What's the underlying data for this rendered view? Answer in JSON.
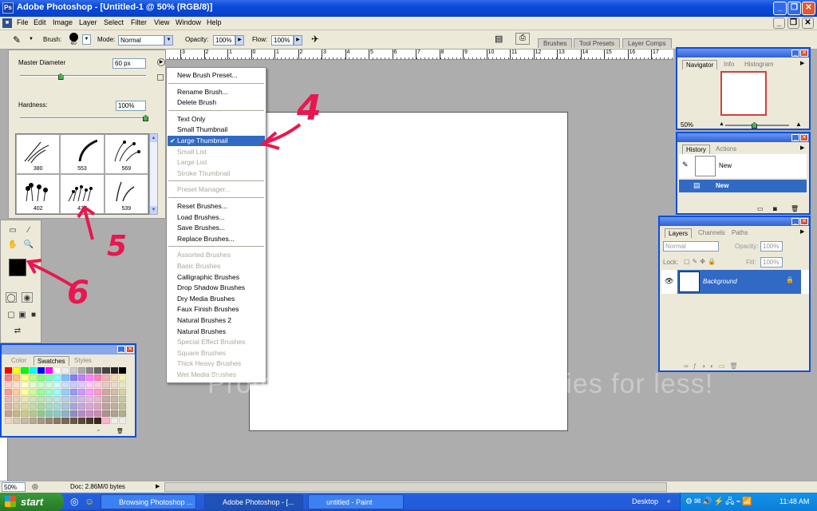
{
  "window": {
    "title": "Adobe Photoshop - [Untitled-1 @ 50% (RGB/8)]"
  },
  "menu": [
    "File",
    "Edit",
    "Image",
    "Layer",
    "Select",
    "Filter",
    "View",
    "Window",
    "Help"
  ],
  "options_bar": {
    "brush_label": "Brush:",
    "brush_size": "60",
    "mode_label": "Mode:",
    "mode_value": "Normal",
    "opacity_label": "Opacity:",
    "opacity_value": "100%",
    "flow_label": "Flow:",
    "flow_value": "100%",
    "well_tabs": [
      "Brushes",
      "Tool Presets",
      "Layer Comps"
    ]
  },
  "ruler_ticks": [
    "3",
    "2",
    "1",
    "0",
    "1",
    "2",
    "3",
    "4",
    "5",
    "6",
    "7",
    "8",
    "9",
    "10",
    "11",
    "12",
    "13",
    "14",
    "15",
    "16",
    "17"
  ],
  "brush_picker": {
    "master_diameter_label": "Master Diameter",
    "master_diameter_value": "60 px",
    "master_diameter_level": 0.32,
    "hardness_label": "Hardness:",
    "hardness_value": "100%",
    "hardness_level": 1.0,
    "thumbnails": [
      "380",
      "553",
      "569",
      "402",
      "437",
      "539"
    ]
  },
  "context_menu": {
    "items": [
      {
        "label": "New Brush Preset...",
        "disabled": false
      },
      {
        "sep": true
      },
      {
        "label": "Rename Brush...",
        "disabled": false
      },
      {
        "label": "Delete Brush",
        "disabled": false
      },
      {
        "sep": true
      },
      {
        "label": "Text Only",
        "disabled": false
      },
      {
        "label": "Small Thumbnail",
        "disabled": false
      },
      {
        "label": "Large Thumbnail",
        "disabled": false,
        "selected": true,
        "checked": true
      },
      {
        "label": "Small List",
        "disabled": true
      },
      {
        "label": "Large List",
        "disabled": true
      },
      {
        "label": "Stroke Thumbnail",
        "disabled": true
      },
      {
        "sep": true
      },
      {
        "label": "Preset Manager...",
        "disabled": true
      },
      {
        "sep": true
      },
      {
        "label": "Reset Brushes...",
        "disabled": false
      },
      {
        "label": "Load Brushes...",
        "disabled": false
      },
      {
        "label": "Save Brushes...",
        "disabled": false
      },
      {
        "label": "Replace Brushes...",
        "disabled": false
      },
      {
        "sep": true
      },
      {
        "label": "Assorted Brushes",
        "disabled": true
      },
      {
        "label": "Basic Brushes",
        "disabled": true
      },
      {
        "label": "Calligraphic Brushes",
        "disabled": false
      },
      {
        "label": "Drop Shadow Brushes",
        "disabled": false
      },
      {
        "label": "Dry Media Brushes",
        "disabled": false
      },
      {
        "label": "Faux Finish Brushes",
        "disabled": false
      },
      {
        "label": "Natural Brushes 2",
        "disabled": false
      },
      {
        "label": "Natural Brushes",
        "disabled": false
      },
      {
        "label": "Special Effect Brushes",
        "disabled": true
      },
      {
        "label": "Square Brushes",
        "disabled": true
      },
      {
        "label": "Thick Heavy Brushes",
        "disabled": true
      },
      {
        "label": "Wet Media Brushes",
        "disabled": true
      }
    ]
  },
  "swatches_panel": {
    "tabs": [
      "Color",
      "Swatches",
      "Styles"
    ],
    "active_tab": "Swatches",
    "colors": [
      "#ff0000",
      "#ffff00",
      "#00ff00",
      "#00ffff",
      "#0000ff",
      "#ff00ff",
      "#ffffff",
      "#eeeeee",
      "#cccccc",
      "#aaaaaa",
      "#888888",
      "#666666",
      "#444444",
      "#222222",
      "#000000",
      "#ff7f7f",
      "#ffbf7f",
      "#ffff7f",
      "#bfff7f",
      "#7fff7f",
      "#7fffbf",
      "#7fffff",
      "#7fbfff",
      "#7f7fff",
      "#bf7fff",
      "#ff7fff",
      "#ff7fbf",
      "#f2b2b2",
      "#f2d9b2",
      "#f2f2b2",
      "#ffcccc",
      "#ffe0cc",
      "#ffffcc",
      "#e0ffcc",
      "#ccffcc",
      "#ccffe0",
      "#ccffff",
      "#cce0ff",
      "#ccccff",
      "#e0ccff",
      "#ffccff",
      "#ffcce0",
      "#e8c8c8",
      "#e8dcc8",
      "#e8e8c8",
      "#ff9999",
      "#ffcc99",
      "#ffff99",
      "#ccff99",
      "#99ff99",
      "#99ffcc",
      "#99ffff",
      "#99ccff",
      "#9999ff",
      "#cc99ff",
      "#ff99ff",
      "#ff99cc",
      "#d4a5a5",
      "#d4bca5",
      "#d4d4a5",
      "#e6b8b8",
      "#e6cfb8",
      "#e6e6b8",
      "#cfe6b8",
      "#b8e6b8",
      "#b8e6cf",
      "#b8e6e6",
      "#b8cfe6",
      "#b8b8e6",
      "#cfb8e6",
      "#e6b8e6",
      "#e6b8cf",
      "#c8a8a8",
      "#c8b8a8",
      "#c8c8a8",
      "#d9b3a6",
      "#d9c7a6",
      "#d9d9a6",
      "#c7d9a6",
      "#a6d9a6",
      "#a6d9c7",
      "#a6d9d9",
      "#a6c7d9",
      "#a6a6d9",
      "#c7a6d9",
      "#d9a6d9",
      "#d9a6c7",
      "#bfa0a0",
      "#bfafa0",
      "#bfbfa0",
      "#c9a28d",
      "#c9b38d",
      "#c9c98d",
      "#b3c98d",
      "#8dc98d",
      "#8dc9b3",
      "#8dc9c9",
      "#8db3c9",
      "#8d8dc9",
      "#b38dc9",
      "#c98dc9",
      "#c98db3",
      "#b09090",
      "#b0a090",
      "#b0b090",
      "#e8d8c8",
      "#d8c8b8",
      "#c8b8a8",
      "#b8a898",
      "#a89888",
      "#988878",
      "#887868",
      "#786858",
      "#685848",
      "#584838",
      "#483828",
      "#382818",
      "#ffb0d0",
      "#ececec",
      "#ececec"
    ]
  },
  "navigator_panel": {
    "tabs": [
      "Navigator",
      "Info",
      "Histogram"
    ],
    "zoom": "50%",
    "zoom_level": 0.45
  },
  "history_panel": {
    "tabs": [
      "History",
      "Actions"
    ],
    "snapshot_label": "New",
    "state_label": "New"
  },
  "layers_panel": {
    "tabs": [
      "Layers",
      "Channels",
      "Paths"
    ],
    "blend_mode": "Normal",
    "opacity_label": "Opacity:",
    "opacity_value": "100%",
    "lock_label": "Lock:",
    "fill_label": "Fill:",
    "fill_value": "100%",
    "layer_name": "Background"
  },
  "status_bar": {
    "zoom": "50%",
    "doc_info": "Doc: 2.86M/0 bytes"
  },
  "taskbar": {
    "start_label": "start",
    "items": [
      "Browsing Photoshop ...",
      "Adobe Photoshop - [...",
      "untitled - Paint"
    ],
    "desktop_label": "Desktop",
    "time": "11:48 AM"
  },
  "annotations": [
    "4",
    "5",
    "6"
  ],
  "colors": {
    "annotation": "#e8174f",
    "selection": "#316ac5",
    "xp_blue": "#0c4fd9",
    "foreground_swatch": "#000000",
    "background_swatch": "#ffffff"
  }
}
